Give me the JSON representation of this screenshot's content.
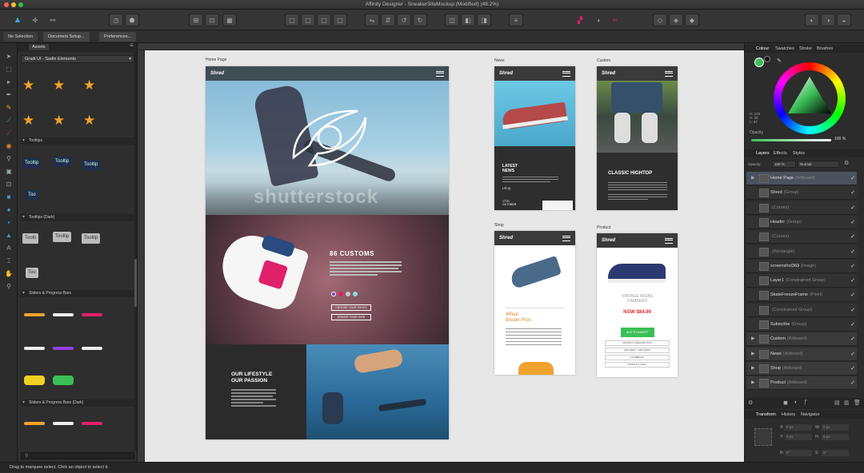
{
  "window": {
    "title": "Affinity Designer - SneakerSiteMockup (Modified) (48.2%)"
  },
  "context_bar": {
    "no_selection": "No Selection",
    "document_setup": "Document Setup...",
    "preferences": "Preferences..."
  },
  "assets_panel": {
    "tab": "Assets",
    "category": "Gradi UI - Sadie Elements",
    "sections": [
      "Tooltips",
      "Tooltips (Dark)",
      "Sliders & Progress Bars",
      "Sliders & Progress Bars (Dark)"
    ],
    "tooltip_labels": [
      "Tooltip",
      "Tooltip",
      "Tooltip",
      "Too"
    ],
    "tooltip_dark_labels": [
      "Toolti",
      "Tooltip",
      "Tooltip",
      "Too"
    ]
  },
  "artboards": {
    "home": {
      "title": "Home Page",
      "logo": "Shred",
      "customs_heading": "86 CUSTOMS",
      "btn1": "CHOOSE YOUR SHOES",
      "btn2": "CREATE YOUR OWN",
      "lifestyle_heading": "OUR LIFESTYLE\nOUR PASSION",
      "watermark": "shutterstock"
    },
    "news": {
      "title": "News",
      "logo": "Shred",
      "heading": "LATEST\nNEWS",
      "date": "17TH\nOCTOBER"
    },
    "custom": {
      "title": "Custom",
      "logo": "Shred",
      "heading": "CLASSIC HIGHTOP"
    },
    "shop": {
      "title": "Shop",
      "logo": "Shred",
      "product_name": "4Real\nBream Pros"
    },
    "product": {
      "title": "Product",
      "logo": "Shred",
      "name": "VINTAGE MIDAS\nCAMBERS",
      "price": "NOW $84.99",
      "cta": "ADD TO BASKET",
      "rows": [
        "PRODUCT DESCRIPTION",
        "DELIVERY + RETURNS",
        "COMMENTS",
        "PRODUCT SPEC"
      ]
    }
  },
  "right_panel": {
    "colour_tabs": [
      "Colour",
      "Swatches",
      "Stroke",
      "Brushes"
    ],
    "hsl": {
      "h": "H: 122",
      "s": "S: 30",
      "l": "L: 67"
    },
    "opacity_label": "Opacity",
    "opacity_value": "100 %",
    "layer_tabs": [
      "Layers",
      "Effects",
      "Styles"
    ],
    "opacity_text": "Opacity:",
    "opacity_field": "100 %",
    "blend": "Normal",
    "layers": [
      {
        "name": "Home Page",
        "sub": "(Artboard)",
        "sel": true
      },
      {
        "name": "Shred",
        "sub": "(Group)"
      },
      {
        "name": "",
        "sub": "(Curves)"
      },
      {
        "name": "Header",
        "sub": "(Group)"
      },
      {
        "name": "",
        "sub": "(Curves)"
      },
      {
        "name": "",
        "sub": "(Rectangle)"
      },
      {
        "name": "screenshot369",
        "sub": "(Image)"
      },
      {
        "name": "Layer1",
        "sub": "(Constrained Group)"
      },
      {
        "name": "SkateFreezeFrame",
        "sub": "(Pixel)"
      },
      {
        "name": "",
        "sub": "(Constrained Group)"
      },
      {
        "name": "Subscribe",
        "sub": "(Group)"
      },
      {
        "name": "Custom",
        "sub": "(Artboard)",
        "ab": true
      },
      {
        "name": "News",
        "sub": "(Artboard)",
        "ab": true
      },
      {
        "name": "Shop",
        "sub": "(Artboard)",
        "ab": true
      },
      {
        "name": "Product",
        "sub": "(Artboard)",
        "ab": true
      }
    ],
    "transform_tabs": [
      "Transform",
      "History",
      "Navigator"
    ],
    "transform": {
      "x": "X:",
      "y": "Y:",
      "w": "W:",
      "h": "H:",
      "r": "R:",
      "s": "S:",
      "xv": "0 px",
      "yv": "0 px",
      "wv": "0 px",
      "hv": "0 px",
      "rv": "0°",
      "sv": "0°"
    }
  },
  "status": "Drag to marquee select. Click an object to select it.",
  "colors": {
    "accent": "#3aa0e0",
    "star": "#f0a22c",
    "pink": "#e0206a",
    "green": "#3bbf57",
    "red": "#e02a2a"
  }
}
